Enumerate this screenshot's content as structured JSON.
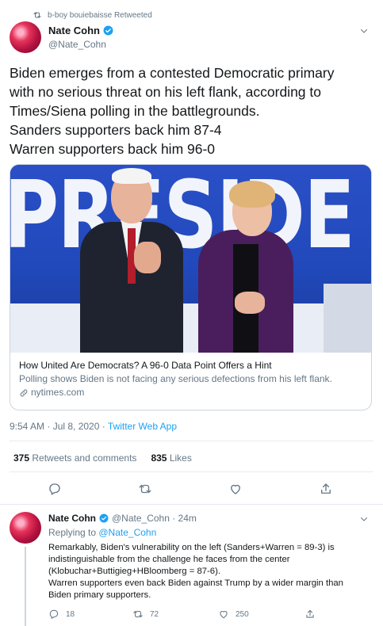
{
  "retweet_header": {
    "text": "b-boy bouiebaisse Retweeted"
  },
  "tweet": {
    "author_name": "Nate Cohn",
    "author_handle": "@Nate_Cohn",
    "text_lines": [
      "Biden emerges from a contested Democratic primary",
      "with no serious threat on his left flank, according to",
      "Times/Siena polling in the battlegrounds.",
      "Sanders supporters back him 87-4",
      "Warren supporters back him 96-0"
    ],
    "card": {
      "image_banner_text": "PRESIDE",
      "title": "How United Are Democrats? A 96-0 Data Point Offers a Hint",
      "description": "Polling shows Biden is not facing any serious defections from his left flank.",
      "domain": "nytimes.com"
    },
    "timestamp": "9:54 AM · Jul 8, 2020 · ",
    "source": "Twitter Web App",
    "retweets_count": "375",
    "retweets_label": "Retweets and comments",
    "likes_count": "835",
    "likes_label": "Likes"
  },
  "reply": {
    "author_name": "Nate Cohn",
    "handle_time": "@Nate_Cohn · 24m",
    "replying_prefix": "Replying to ",
    "replying_handle": "@Nate_Cohn",
    "text_lines": [
      "Remarkably, Biden's vulnerability on the left (Sanders+Warren = 89-3) is",
      "indistinguishable from the challenge he faces from the center",
      "(Klobuchar+Buttigieg+HBloomberg = 87-6).",
      "Warren supporters even back Biden against Trump by a wider margin than",
      "Biden primary supporters."
    ],
    "reply_count": "18",
    "retweet_count": "72",
    "like_count": "250"
  },
  "colors": {
    "accent": "#1da1f2",
    "muted": "#657786",
    "border": "#e6ecf0"
  },
  "icons": [
    "retweet-icon",
    "verified-badge-icon",
    "chevron-down-icon",
    "link-icon",
    "reply-icon",
    "like-icon",
    "share-icon"
  ]
}
